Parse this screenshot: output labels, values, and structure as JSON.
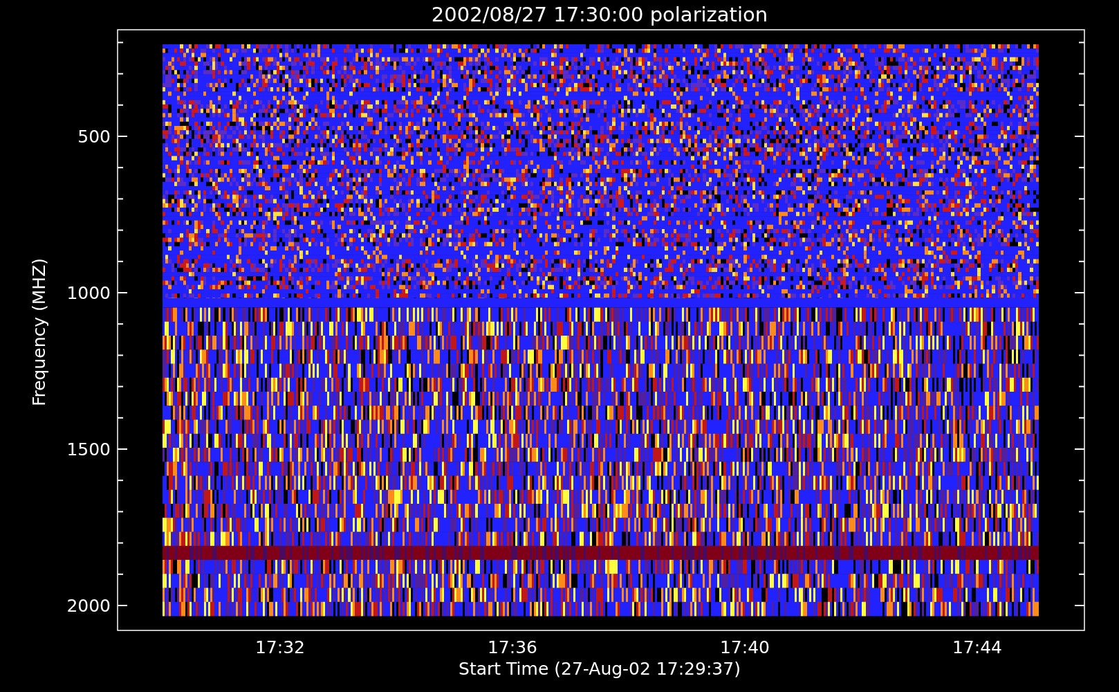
{
  "plot": {
    "title": "2002/08/27 17:30:00 polarization",
    "ylabel": "Frequency (MHZ)",
    "xlabel": "Start Time (27-Aug-02 17:29:37)",
    "yticks": [
      "500",
      "1000",
      "1500",
      "2000"
    ],
    "xticks": [
      "17:32",
      "17:36",
      "17:40",
      "17:44"
    ]
  }
}
